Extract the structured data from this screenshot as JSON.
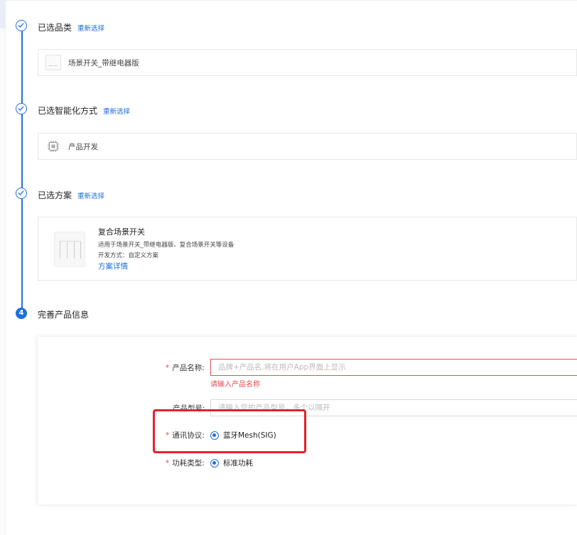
{
  "steps": {
    "category": {
      "title": "已选品类",
      "reselect": "重新选择",
      "value": "场景开关_带继电器版"
    },
    "method": {
      "title": "已选智能化方式",
      "reselect": "重新选择",
      "value": "产品开发"
    },
    "plan": {
      "title": "已选方案",
      "reselect": "重新选择",
      "name": "复合场景开关",
      "desc": "适用于场景开关_带继电器版、复合场景开关等设备",
      "dev_mode": "开发方式：自定义方案",
      "details": "方案详情"
    },
    "info": {
      "number": "4",
      "title": "完善产品信息"
    }
  },
  "form": {
    "product_name": {
      "label": "产品名称:",
      "placeholder": "品牌+产品名,将在用户App界面上显示",
      "error": "请输入产品名称"
    },
    "product_model": {
      "label": "产品型号:",
      "placeholder": "请输入您的产品型号，多个以隔开"
    },
    "protocol": {
      "label": "通讯协议:",
      "option": "蓝牙Mesh(SIG)"
    },
    "power": {
      "label": "功耗类型:",
      "option": "标准功耗"
    }
  },
  "colors": {
    "accent": "#1f6fe0",
    "error": "#e34d59",
    "highlight": "#e8202a"
  }
}
